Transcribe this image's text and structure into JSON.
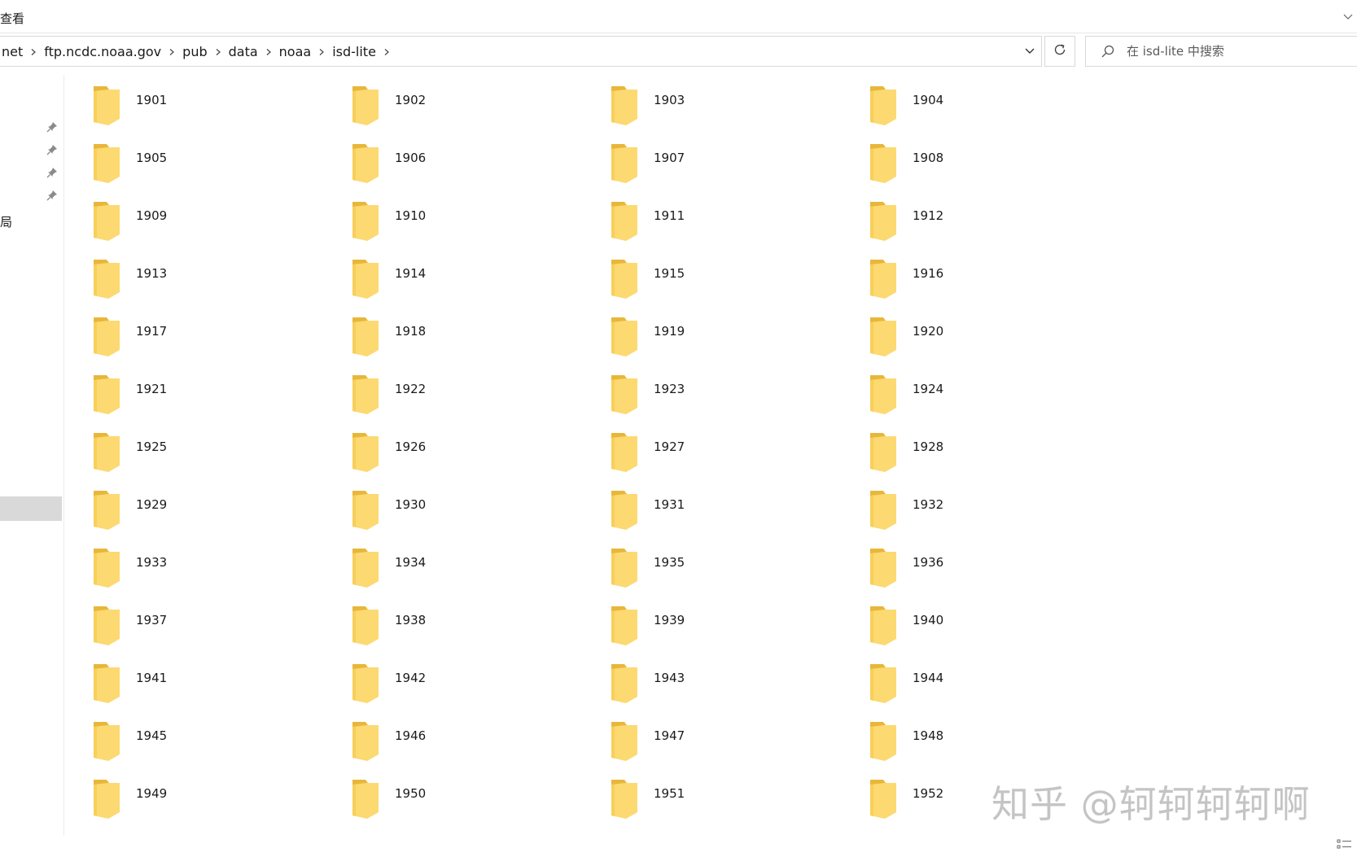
{
  "ribbon": {
    "tab_view": "查看"
  },
  "address_bar": {
    "crumbs": [
      "net",
      "ftp.ncdc.noaa.gov",
      "pub",
      "data",
      "noaa",
      "isd-lite"
    ]
  },
  "search": {
    "placeholder": "在 isd-lite 中搜索"
  },
  "nav_pane": {
    "fragment_label": "局"
  },
  "folders": [
    "1901",
    "1902",
    "1903",
    "1904",
    "1905",
    "1906",
    "1907",
    "1908",
    "1909",
    "1910",
    "1911",
    "1912",
    "1913",
    "1914",
    "1915",
    "1916",
    "1917",
    "1918",
    "1919",
    "1920",
    "1921",
    "1922",
    "1923",
    "1924",
    "1925",
    "1926",
    "1927",
    "1928",
    "1929",
    "1930",
    "1931",
    "1932",
    "1933",
    "1934",
    "1935",
    "1936",
    "1937",
    "1938",
    "1939",
    "1940",
    "1941",
    "1942",
    "1943",
    "1944",
    "1945",
    "1946",
    "1947",
    "1948",
    "1949",
    "1950",
    "1951",
    "1952"
  ],
  "watermark": "知乎 @轲轲轲轲啊",
  "colors": {
    "folder_back": "#e8b73a",
    "folder_front": "#fcd971",
    "folder_shade": "#f5c84a"
  },
  "icons": {
    "pin": "pin-icon",
    "chevron": "chevron-right-icon",
    "dropdown": "chevron-down-icon",
    "refresh": "refresh-icon",
    "search": "search-icon",
    "folder": "folder-icon"
  }
}
